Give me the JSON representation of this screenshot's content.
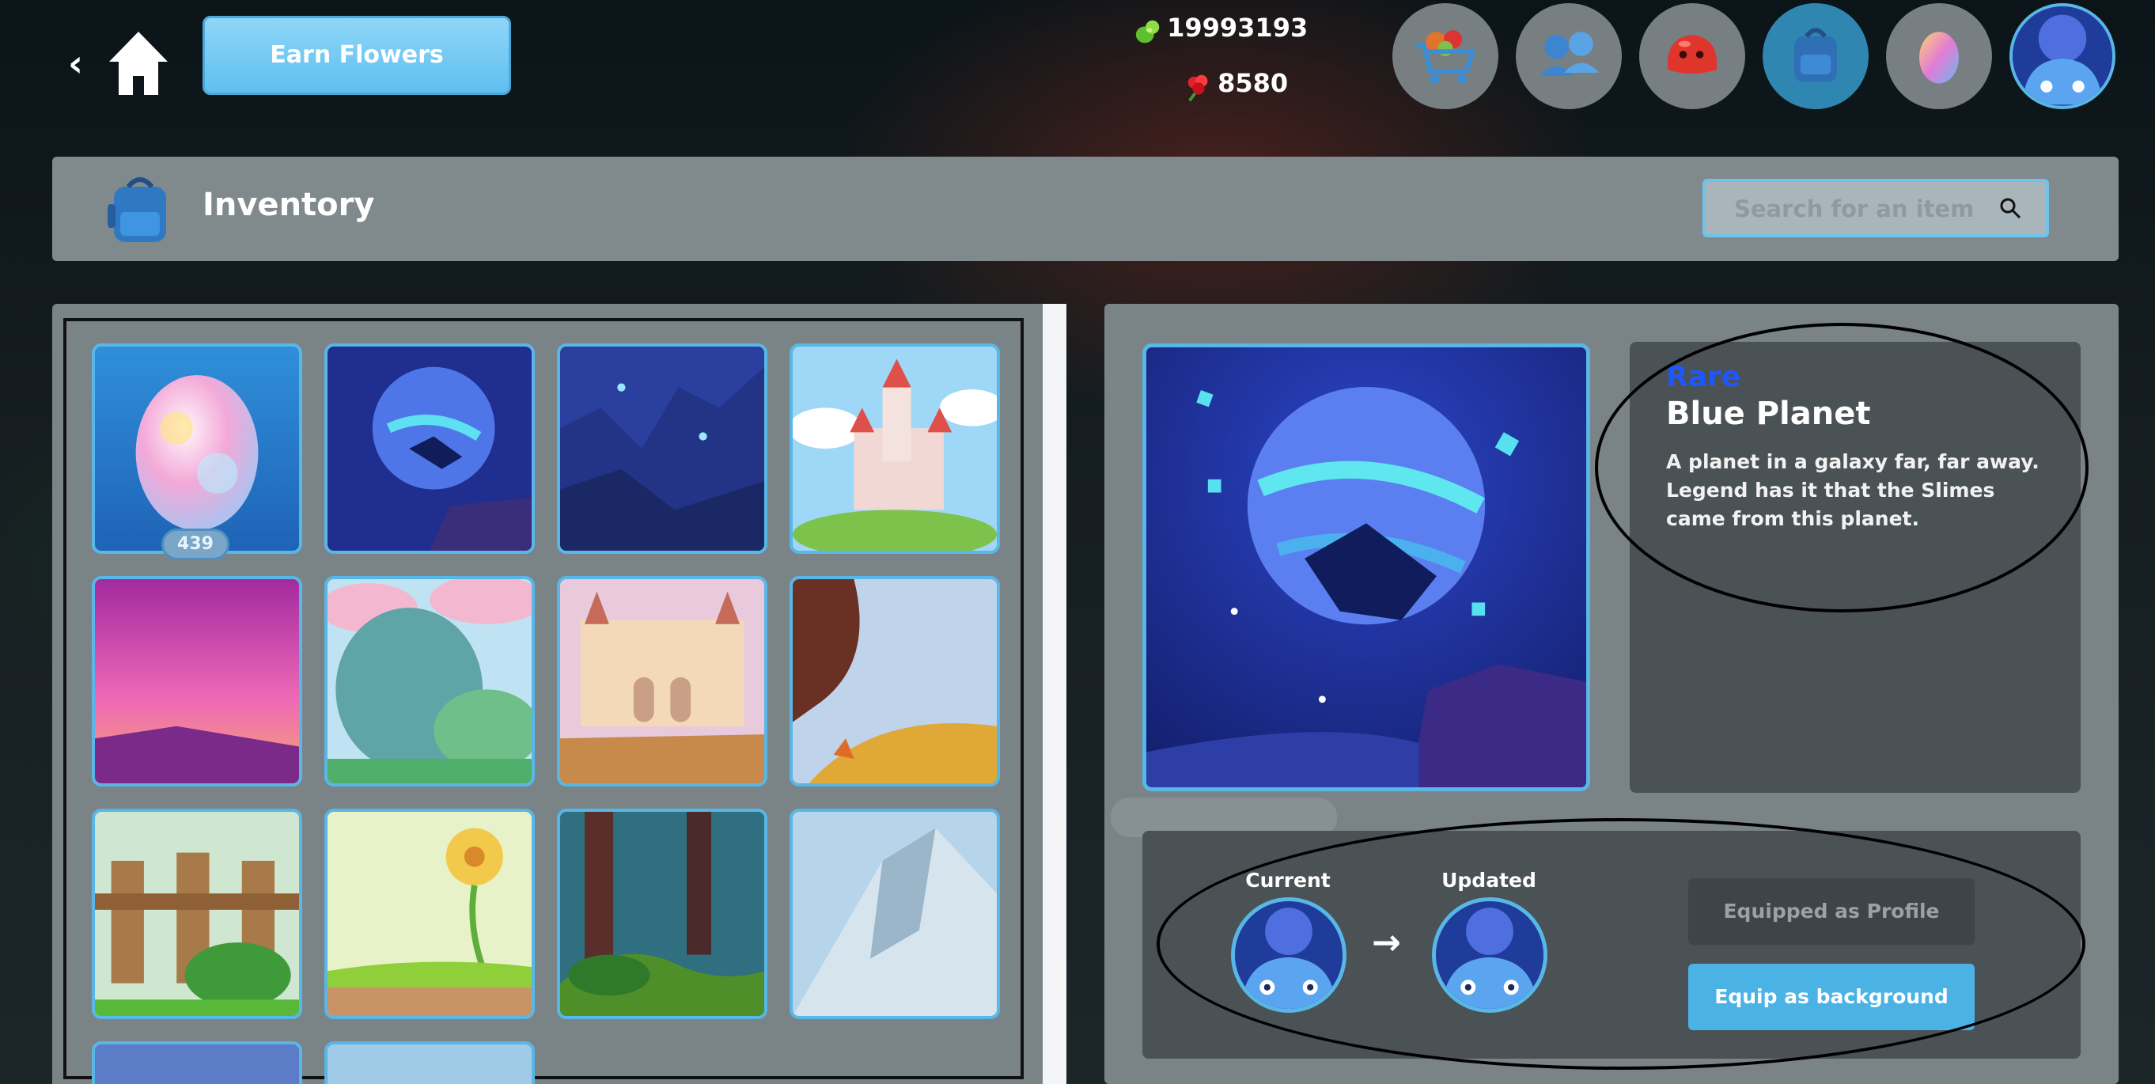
{
  "topbar": {
    "back_label": "‹",
    "earn_button_label": "Earn Flowers",
    "currency_gems": "19993193",
    "currency_flowers": "8580",
    "nav_icons": [
      "shop-cart-icon",
      "friends-icon",
      "slime-icon",
      "backpack-icon",
      "egg-icon",
      "profile-avatar-icon"
    ],
    "active_nav": "backpack-icon"
  },
  "inventory": {
    "title": "Inventory",
    "search_placeholder": "Search for an item"
  },
  "grid": {
    "egg_count": "439",
    "items": [
      "egg",
      "blue-planet",
      "blue-canyon",
      "castle",
      "pink-sunset",
      "pink-forest",
      "sand-castle",
      "autumn-cliff",
      "garden-fence",
      "flower-meadow",
      "dark-forest",
      "ice-mountain",
      "partial-1",
      "partial-2"
    ]
  },
  "selected_item": {
    "rarity": "Rare",
    "name": "Blue Planet",
    "description": "A planet in a galaxy far, far away. Legend has it that the Slimes came from this planet.",
    "rarity_color": "#1e56ff"
  },
  "equip": {
    "current_label": "Current",
    "updated_label": "Updated",
    "equipped_profile_label": "Equipped as Profile",
    "equip_background_label": "Equip as background"
  },
  "colors": {
    "accent": "#58b7e6",
    "button_blue": "#4bb2e6",
    "panel": "#7a8487"
  }
}
